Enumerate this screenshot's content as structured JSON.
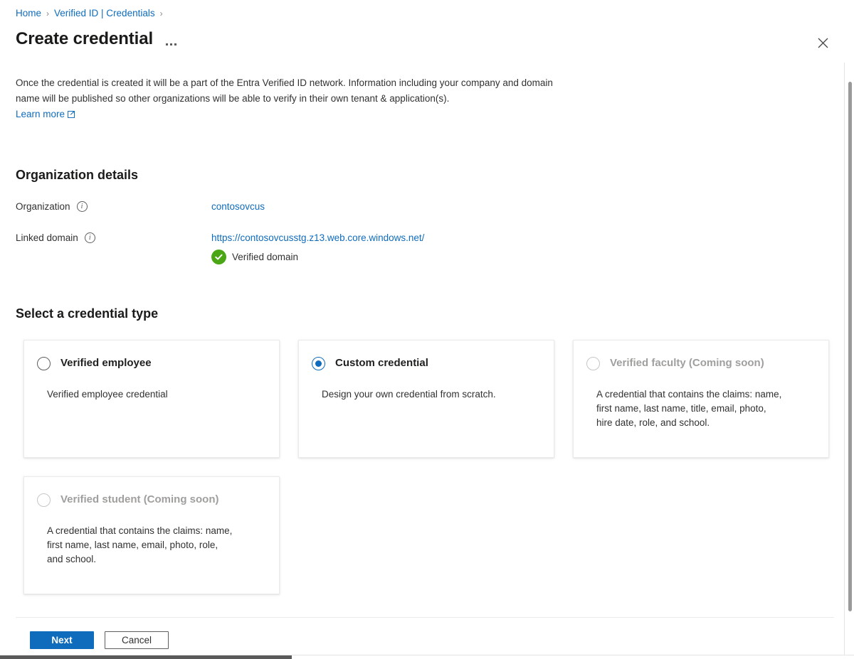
{
  "breadcrumb": {
    "items": [
      {
        "label": "Home"
      },
      {
        "label": "Verified ID | Credentials"
      }
    ],
    "separator": "›"
  },
  "header": {
    "title": "Create credential",
    "overflow_menu_label": "...",
    "close_label": "✕"
  },
  "intro": {
    "text": "Once the credential is created it will be a part of the Entra Verified ID network. Information including your company and domain name will be published so other organizations will be able to verify in their own tenant & application(s).",
    "learn_more_label": "Learn more",
    "external_link_icon": "external-link-icon"
  },
  "organization_section": {
    "heading": "Organization details",
    "fields": [
      {
        "label": "Organization",
        "info_icon": "info-icon",
        "value": "contosovcus",
        "is_link": true
      },
      {
        "label": "Linked domain",
        "info_icon": "info-icon",
        "value": "https://contosovcusstg.z13.web.core.windows.net/",
        "is_link": true,
        "status_icon": "green-check-icon",
        "status_text": "Verified domain"
      }
    ]
  },
  "credential_type_section": {
    "heading": "Select a credential type",
    "cards": [
      {
        "title": "Verified employee",
        "description": "Verified employee credential",
        "selected": false,
        "disabled": false
      },
      {
        "title": "Custom credential",
        "description": "Design your own credential from scratch.",
        "selected": true,
        "disabled": false
      },
      {
        "title": "Verified faculty (Coming soon)",
        "description": "A credential that contains the claims: name,\nfirst name, last name, title, email, photo,\nhire date, role, and school.",
        "selected": false,
        "disabled": true
      },
      {
        "title": "Verified student (Coming soon)",
        "description": "A credential that contains the claims: name,\nfirst name, last name, email, photo, role,\nand school.",
        "selected": false,
        "disabled": true
      }
    ]
  },
  "footer": {
    "next_label": "Next",
    "cancel_label": "Cancel"
  },
  "colors": {
    "link": "#0f6cbd",
    "primary_button": "#0f6cbd",
    "verified_green": "#4aa614",
    "disabled_text": "#a19f9d",
    "card_border": "#edebe9"
  }
}
